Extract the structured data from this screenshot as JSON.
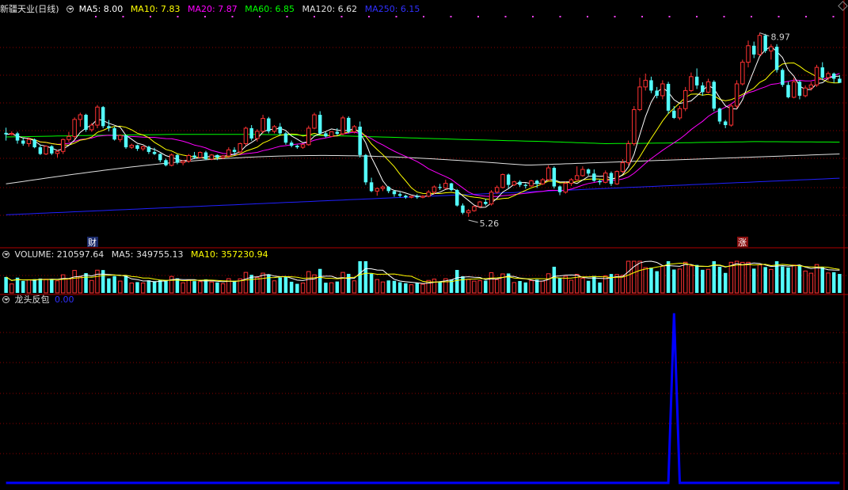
{
  "stock": {
    "name": "新疆天业",
    "period": "(日线)",
    "name_label": "新疆天业(日线)"
  },
  "ma_legend": {
    "ma5": "MA5: 8.00",
    "ma10": "MA10: 7.83",
    "ma20": "MA20: 7.87",
    "ma60": "MA60: 6.85",
    "ma120": "MA120: 6.62",
    "ma250": "MA250: 6.15"
  },
  "volume_legend": {
    "volume": "VOLUME: 210597.64",
    "ma5": "MA5: 349755.13",
    "ma10": "MA10: 357230.94"
  },
  "indicator_legend": {
    "name": "龙头反包",
    "value": "0.00"
  },
  "annotations": {
    "high_label": "8.97",
    "low_label": "5.26",
    "badge_cai": "财",
    "badge_zhang": "涨"
  },
  "colors": {
    "background": "#000000",
    "up": "#ff3232",
    "down": "#54ffff",
    "ma5": "#ffffff",
    "ma10": "#ffff00",
    "ma20": "#ff00ff",
    "ma60": "#00ff00",
    "ma120": "#e0e0e0",
    "ma250": "#2020ff",
    "grid": "#8b0000",
    "indicator": "#0000ff"
  },
  "chart_data": [
    {
      "type": "candlestick",
      "panel": "price",
      "ylim": [
        5.0,
        9.3
      ],
      "high_mark": 8.97,
      "low_mark": 5.26,
      "candles": [
        [
          7.03,
          7.13,
          6.88,
          7.0
        ],
        [
          7.0,
          7.06,
          6.98,
          7.02
        ],
        [
          7.02,
          7.05,
          6.82,
          6.88
        ],
        [
          6.88,
          6.93,
          6.78,
          6.82
        ],
        [
          6.82,
          6.94,
          6.76,
          6.9
        ],
        [
          6.9,
          6.92,
          6.73,
          6.75
        ],
        [
          6.75,
          6.8,
          6.6,
          6.62
        ],
        [
          6.62,
          6.79,
          6.6,
          6.77
        ],
        [
          6.77,
          6.79,
          6.6,
          6.63
        ],
        [
          6.63,
          6.7,
          6.55,
          6.67
        ],
        [
          6.67,
          6.92,
          6.62,
          6.9
        ],
        [
          6.9,
          7.05,
          6.85,
          6.96
        ],
        [
          6.96,
          7.33,
          6.9,
          7.29
        ],
        [
          7.29,
          7.42,
          7.15,
          7.38
        ],
        [
          7.38,
          7.4,
          7.05,
          7.09
        ],
        [
          7.09,
          7.22,
          7.05,
          7.18
        ],
        [
          7.18,
          7.57,
          7.12,
          7.53
        ],
        [
          7.53,
          7.55,
          7.12,
          7.16
        ],
        [
          7.16,
          7.28,
          7.06,
          7.12
        ],
        [
          7.12,
          7.15,
          6.88,
          6.9
        ],
        [
          6.9,
          7.0,
          6.85,
          6.98
        ],
        [
          6.98,
          6.99,
          6.72,
          6.75
        ],
        [
          6.75,
          6.82,
          6.72,
          6.79
        ],
        [
          6.79,
          6.8,
          6.68,
          6.72
        ],
        [
          6.72,
          6.78,
          6.68,
          6.76
        ],
        [
          6.76,
          6.78,
          6.62,
          6.66
        ],
        [
          6.66,
          6.74,
          6.6,
          6.62
        ],
        [
          6.62,
          6.63,
          6.46,
          6.5
        ],
        [
          6.5,
          6.53,
          6.38,
          6.4
        ],
        [
          6.4,
          6.63,
          6.38,
          6.6
        ],
        [
          6.6,
          6.62,
          6.42,
          6.45
        ],
        [
          6.45,
          6.5,
          6.4,
          6.48
        ],
        [
          6.48,
          6.62,
          6.45,
          6.59
        ],
        [
          6.59,
          6.66,
          6.52,
          6.55
        ],
        [
          6.55,
          6.67,
          6.54,
          6.65
        ],
        [
          6.65,
          6.68,
          6.5,
          6.52
        ],
        [
          6.52,
          6.62,
          6.5,
          6.6
        ],
        [
          6.6,
          6.61,
          6.5,
          6.55
        ],
        [
          6.55,
          6.6,
          6.52,
          6.58
        ],
        [
          6.58,
          6.75,
          6.55,
          6.7
        ],
        [
          6.7,
          6.75,
          6.6,
          6.66
        ],
        [
          6.66,
          6.84,
          6.64,
          6.82
        ],
        [
          6.82,
          7.15,
          6.78,
          7.12
        ],
        [
          7.12,
          7.18,
          6.88,
          6.92
        ],
        [
          6.92,
          7.1,
          6.86,
          7.06
        ],
        [
          7.06,
          7.38,
          7.02,
          7.31
        ],
        [
          7.31,
          7.34,
          7.02,
          7.06
        ],
        [
          7.06,
          7.18,
          7.02,
          7.15
        ],
        [
          7.15,
          7.22,
          6.98,
          7.02
        ],
        [
          7.02,
          7.05,
          6.8,
          6.84
        ],
        [
          6.84,
          6.88,
          6.75,
          6.78
        ],
        [
          6.78,
          6.8,
          6.72,
          6.75
        ],
        [
          6.75,
          6.82,
          6.72,
          6.8
        ],
        [
          6.8,
          7.17,
          6.78,
          7.12
        ],
        [
          7.12,
          7.42,
          7.1,
          7.38
        ],
        [
          7.38,
          7.45,
          7.0,
          7.02
        ],
        [
          7.02,
          7.05,
          6.94,
          6.96
        ],
        [
          6.96,
          7.06,
          6.95,
          7.05
        ],
        [
          7.05,
          7.12,
          6.98,
          7.01
        ],
        [
          7.01,
          7.36,
          6.98,
          7.32
        ],
        [
          7.32,
          7.35,
          7.02,
          7.05
        ],
        [
          7.05,
          7.18,
          7.02,
          7.15
        ],
        [
          7.15,
          7.25,
          6.55,
          6.6
        ],
        [
          6.6,
          6.62,
          6.02,
          6.07
        ],
        [
          6.07,
          6.16,
          5.88,
          5.9
        ],
        [
          5.9,
          5.97,
          5.81,
          5.95
        ],
        [
          5.95,
          6.01,
          5.9,
          5.98
        ],
        [
          5.98,
          6.0,
          5.86,
          5.9
        ],
        [
          5.9,
          5.92,
          5.79,
          5.84
        ],
        [
          5.84,
          5.88,
          5.78,
          5.81
        ],
        [
          5.81,
          5.83,
          5.75,
          5.78
        ],
        [
          5.78,
          5.81,
          5.76,
          5.8
        ],
        [
          5.8,
          5.84,
          5.75,
          5.78
        ],
        [
          5.78,
          5.82,
          5.76,
          5.8
        ],
        [
          5.8,
          5.92,
          5.78,
          5.88
        ],
        [
          5.88,
          6.01,
          5.84,
          5.98
        ],
        [
          5.98,
          6.04,
          5.92,
          5.96
        ],
        [
          5.96,
          6.12,
          5.94,
          6.05
        ],
        [
          6.05,
          6.06,
          5.9,
          5.92
        ],
        [
          5.92,
          5.94,
          5.6,
          5.62
        ],
        [
          5.62,
          5.66,
          5.45,
          5.48
        ],
        [
          5.48,
          5.55,
          5.4,
          5.52
        ],
        [
          5.52,
          5.62,
          5.5,
          5.6
        ],
        [
          5.6,
          5.71,
          5.58,
          5.69
        ],
        [
          5.69,
          5.75,
          5.62,
          5.65
        ],
        [
          5.65,
          5.92,
          5.62,
          5.88
        ],
        [
          5.88,
          6.01,
          5.85,
          5.97
        ],
        [
          5.97,
          6.24,
          5.95,
          6.22
        ],
        [
          6.22,
          6.24,
          5.95,
          6.02
        ],
        [
          6.02,
          6.1,
          6.0,
          6.08
        ],
        [
          6.08,
          6.11,
          5.98,
          6.02
        ],
        [
          6.02,
          6.05,
          5.95,
          6.0
        ],
        [
          6.0,
          6.12,
          5.98,
          6.1
        ],
        [
          6.1,
          6.12,
          5.96,
          6.04
        ],
        [
          6.04,
          6.15,
          6.02,
          6.12
        ],
        [
          6.12,
          6.4,
          6.1,
          6.35
        ],
        [
          6.35,
          6.38,
          5.95,
          5.99
        ],
        [
          5.99,
          6.01,
          5.82,
          5.88
        ],
        [
          5.88,
          6.08,
          5.85,
          6.05
        ],
        [
          6.05,
          6.15,
          6.0,
          6.12
        ],
        [
          6.12,
          6.38,
          6.1,
          6.2
        ],
        [
          6.2,
          6.38,
          6.18,
          6.32
        ],
        [
          6.32,
          6.34,
          6.2,
          6.24
        ],
        [
          6.24,
          6.32,
          6.08,
          6.1
        ],
        [
          6.1,
          6.12,
          6.02,
          6.07
        ],
        [
          6.07,
          6.3,
          6.05,
          6.25
        ],
        [
          6.25,
          6.28,
          6.0,
          6.04
        ],
        [
          6.04,
          6.3,
          6.02,
          6.28
        ],
        [
          6.28,
          6.52,
          6.25,
          6.45
        ],
        [
          6.45,
          6.88,
          6.4,
          6.82
        ],
        [
          6.82,
          7.55,
          6.78,
          7.48
        ],
        [
          7.48,
          8.1,
          7.45,
          7.92
        ],
        [
          7.92,
          8.18,
          7.85,
          8.05
        ],
        [
          8.05,
          8.12,
          7.8,
          7.85
        ],
        [
          7.85,
          7.92,
          7.7,
          7.75
        ],
        [
          7.75,
          8.05,
          7.68,
          7.98
        ],
        [
          7.98,
          8.02,
          7.4,
          7.46
        ],
        [
          7.46,
          7.55,
          7.3,
          7.32
        ],
        [
          7.32,
          7.55,
          7.28,
          7.5
        ],
        [
          7.5,
          7.92,
          7.45,
          7.85
        ],
        [
          7.85,
          8.2,
          7.82,
          8.12
        ],
        [
          8.12,
          8.28,
          7.88,
          7.95
        ],
        [
          7.95,
          8.01,
          7.75,
          7.82
        ],
        [
          7.82,
          8.08,
          7.8,
          8.02
        ],
        [
          8.02,
          8.05,
          7.45,
          7.5
        ],
        [
          7.5,
          7.52,
          7.2,
          7.25
        ],
        [
          7.25,
          7.28,
          7.12,
          7.18
        ],
        [
          7.18,
          7.6,
          7.15,
          7.55
        ],
        [
          7.55,
          8.05,
          7.5,
          7.98
        ],
        [
          7.98,
          8.45,
          7.95,
          8.4
        ],
        [
          8.4,
          8.82,
          8.3,
          8.72
        ],
        [
          8.72,
          8.8,
          8.48,
          8.55
        ],
        [
          8.55,
          8.97,
          8.52,
          8.92
        ],
        [
          8.92,
          8.95,
          8.58,
          8.62
        ],
        [
          8.62,
          8.75,
          8.45,
          8.7
        ],
        [
          8.7,
          8.75,
          8.2,
          8.25
        ],
        [
          8.25,
          8.28,
          7.92,
          7.96
        ],
        [
          7.96,
          8.02,
          7.7,
          7.72
        ],
        [
          7.72,
          8.1,
          7.7,
          8.02
        ],
        [
          8.02,
          8.05,
          7.68,
          7.75
        ],
        [
          7.75,
          7.95,
          7.72,
          7.9
        ],
        [
          7.9,
          8.02,
          7.85,
          7.96
        ],
        [
          7.96,
          8.35,
          7.92,
          8.3
        ],
        [
          8.3,
          8.4,
          8.05,
          8.1
        ],
        [
          8.1,
          8.22,
          8.04,
          8.18
        ],
        [
          8.18,
          8.2,
          8.0,
          8.08
        ],
        [
          8.08,
          8.15,
          8.0,
          8.0
        ]
      ],
      "ma250_endpoints": [
        5.44,
        6.15
      ],
      "ma120_endpoints": [
        6.04,
        6.62
      ],
      "ma60": [
        6.95,
        6.98,
        7.0,
        7.0,
        6.98,
        6.95,
        6.9,
        6.86,
        6.82,
        6.83,
        6.86,
        6.85
      ],
      "ma60_x_fraction": [
        0.0,
        0.1,
        0.2,
        0.3,
        0.38,
        0.45,
        0.55,
        0.65,
        0.72,
        0.78,
        0.9,
        1.0
      ]
    },
    {
      "type": "bar",
      "panel": "volume",
      "legend": [
        "VOLUME",
        "MA5",
        "MA10"
      ],
      "ylim": [
        0,
        1000000
      ]
    },
    {
      "type": "line",
      "panel": "indicator",
      "series": [
        {
          "name": "龙头反包",
          "spike_index": 117,
          "spike_value": 1.0
        }
      ],
      "ylim": [
        0,
        1.05
      ]
    }
  ]
}
